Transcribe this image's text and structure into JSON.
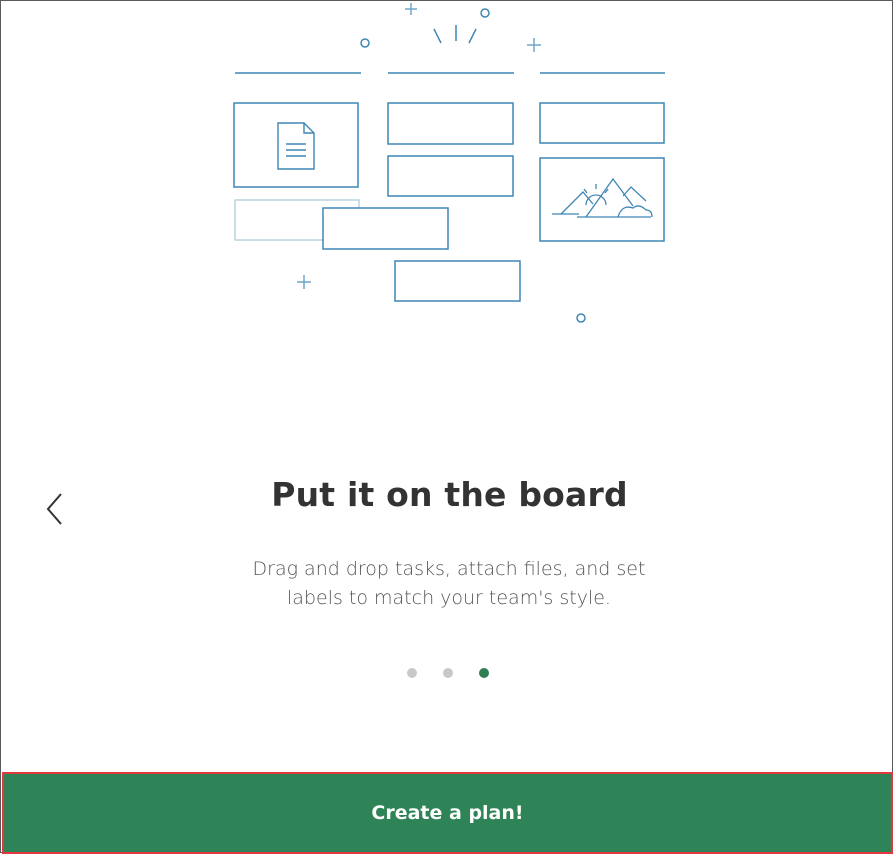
{
  "slide": {
    "title": "Put it on the board",
    "description": "Drag and drop tasks, attach files, and set labels to match your team's style."
  },
  "pagination": {
    "total": 3,
    "active_index": 2
  },
  "create_button": {
    "label": "Create a plan!"
  },
  "colors": {
    "accent_green": "#2e8456",
    "active_dot": "#2e7d53",
    "inactive_dot": "#c8c8c8",
    "illustration_blue": "#3f86b5",
    "illustration_light_blue": "#b9d3e4",
    "button_outline": "#e0393e"
  },
  "icons": {
    "prev": "chevron-left-icon",
    "document": "document-icon",
    "image": "image-landscape-icon"
  }
}
